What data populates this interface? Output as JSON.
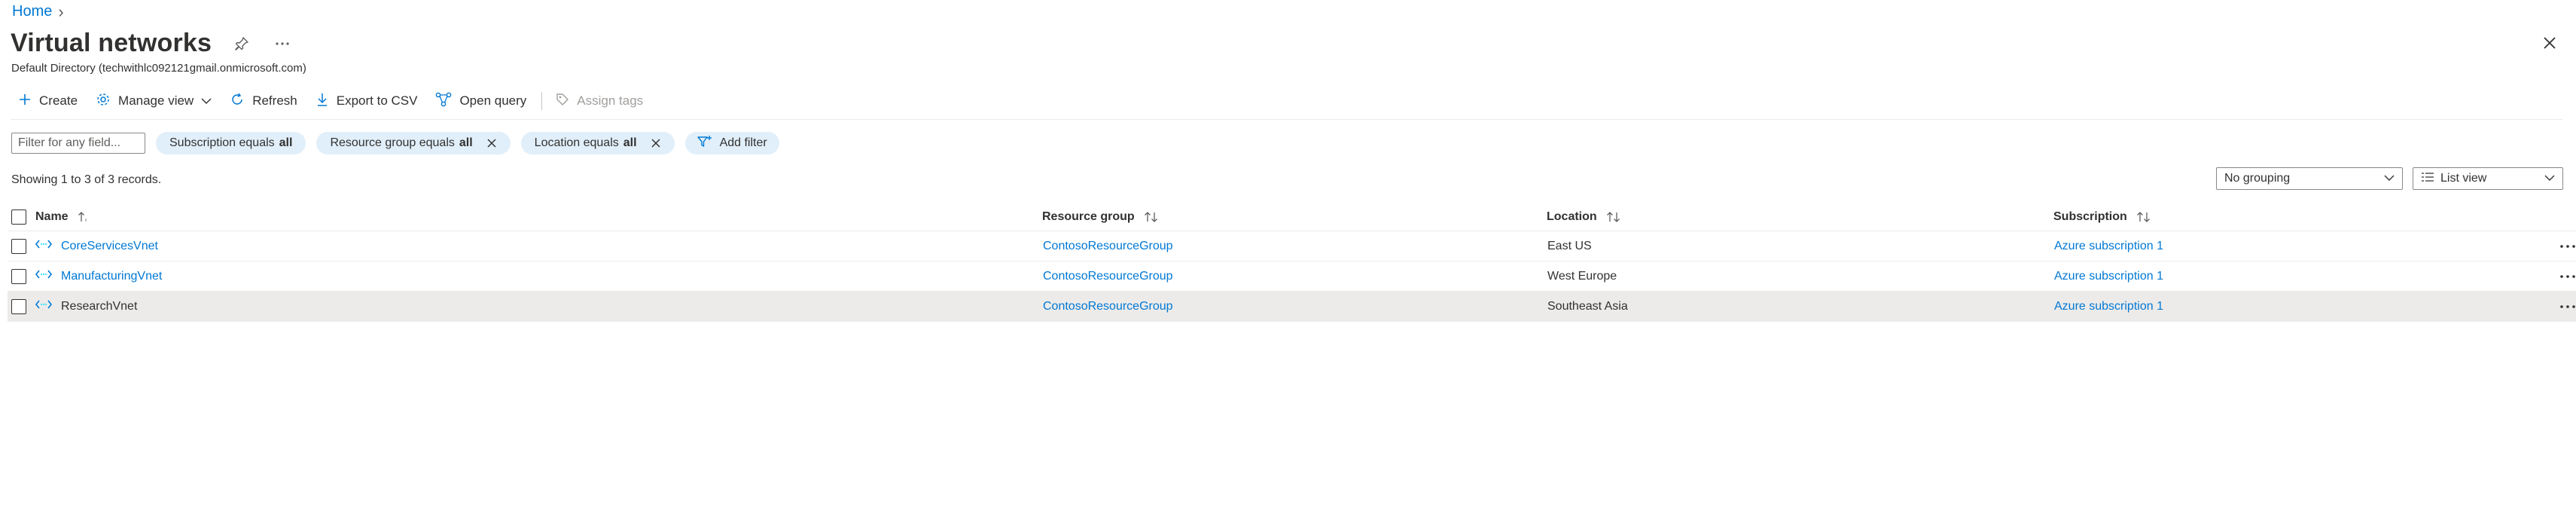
{
  "breadcrumb": {
    "home": "Home",
    "separator": "›"
  },
  "header": {
    "title": "Virtual networks",
    "subtitle": "Default Directory (techwithlc092121gmail.onmicrosoft.com)"
  },
  "toolbar": {
    "create": "Create",
    "manage_view": "Manage view",
    "refresh": "Refresh",
    "export_csv": "Export to CSV",
    "open_query": "Open query",
    "assign_tags": "Assign tags"
  },
  "filters": {
    "placeholder": "Filter for any field...",
    "subscription": {
      "label": "Subscription equals",
      "value": "all"
    },
    "resource_group": {
      "label": "Resource group equals",
      "value": "all"
    },
    "location": {
      "label": "Location equals",
      "value": "all"
    },
    "add_filter": "Add filter"
  },
  "records_text": "Showing 1 to 3 of 3 records.",
  "grouping": {
    "selected": "No grouping"
  },
  "view": {
    "selected": "List view"
  },
  "table": {
    "columns": {
      "name": "Name",
      "resource_group": "Resource group",
      "location": "Location",
      "subscription": "Subscription"
    },
    "rows": [
      {
        "name": "CoreServicesVnet",
        "resource_group": "ContosoResourceGroup",
        "location": "East US",
        "subscription": "Azure subscription 1"
      },
      {
        "name": "ManufacturingVnet",
        "resource_group": "ContosoResourceGroup",
        "location": "West Europe",
        "subscription": "Azure subscription 1"
      },
      {
        "name": "ResearchVnet",
        "resource_group": "ContosoResourceGroup",
        "location": "Southeast Asia",
        "subscription": "Azure subscription 1"
      }
    ]
  },
  "colors": {
    "accent": "#0078d4",
    "pill": "#e1effa",
    "selected_row": "#edebe9"
  }
}
